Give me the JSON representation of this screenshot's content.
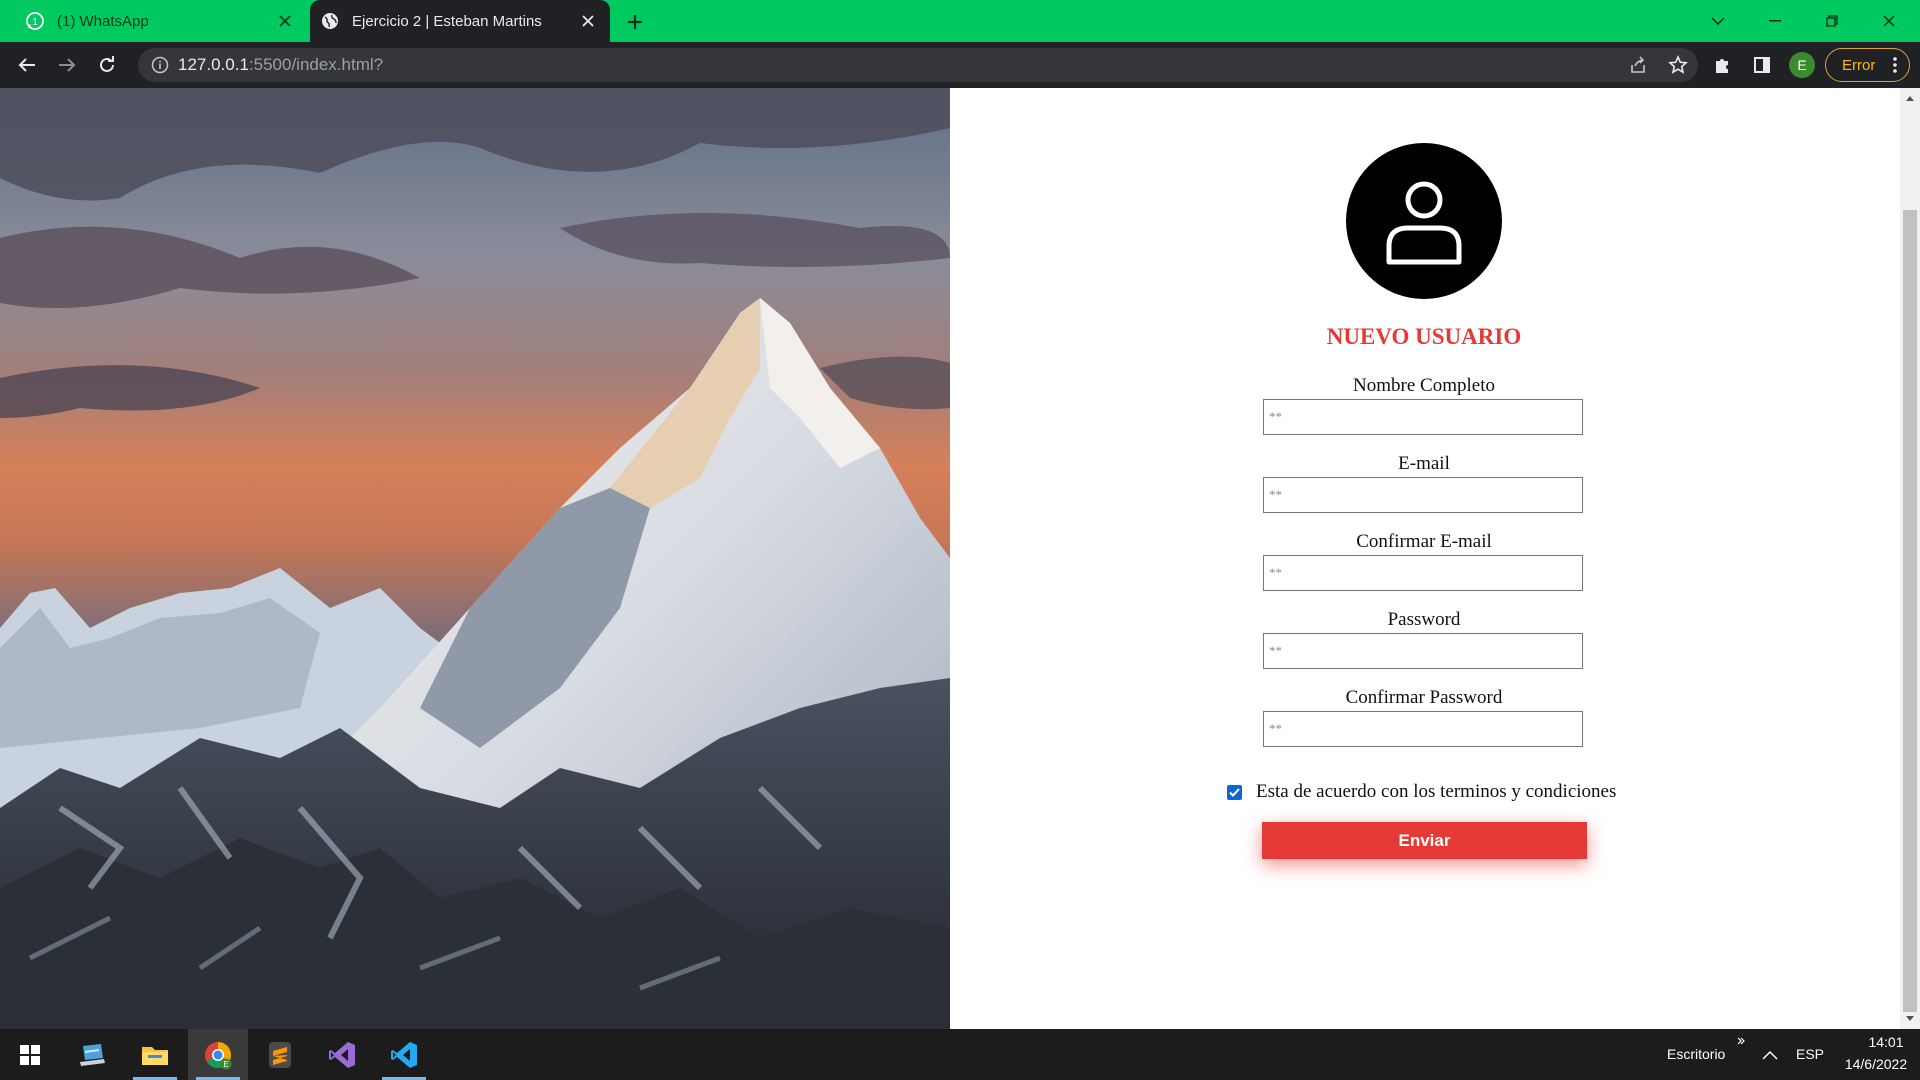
{
  "browser": {
    "tabs": [
      {
        "title": "(1) WhatsApp",
        "icon": "whatsapp-icon",
        "active": false
      },
      {
        "title": "Ejercicio 2 | Esteban Martins",
        "icon": "globe-icon",
        "active": true
      }
    ],
    "url_host": "127.0.0.1",
    "url_rest": ":5500/index.html?",
    "profile_initial": "E",
    "error_label": "Error",
    "accent_color": "#00c95f"
  },
  "form": {
    "title": "NUEVO USUARIO",
    "fields": [
      {
        "label": "Nombre Completo",
        "placeholder": "**"
      },
      {
        "label": "E-mail",
        "placeholder": "**"
      },
      {
        "label": "Confirmar E-mail",
        "placeholder": "**"
      },
      {
        "label": "Password",
        "placeholder": "**"
      },
      {
        "label": "Confirmar Password",
        "placeholder": "**"
      }
    ],
    "terms_text": "Esta de acuerdo con los terminos y condiciones",
    "terms_checked": true,
    "submit_label": "Enviar",
    "accent_color": "#e53935"
  },
  "taskbar": {
    "apps": [
      {
        "name": "windows-start",
        "icon": "windows-icon"
      },
      {
        "name": "desktop-app",
        "icon": "laptop-icon"
      },
      {
        "name": "file-explorer",
        "icon": "folder-icon"
      },
      {
        "name": "chrome",
        "icon": "chrome-icon"
      },
      {
        "name": "sublime-text",
        "icon": "sublime-icon"
      },
      {
        "name": "visual-studio",
        "icon": "visual-studio-icon"
      },
      {
        "name": "vscode",
        "icon": "vscode-icon"
      }
    ],
    "desktop_label": "Escritorio",
    "language": "ESP",
    "time": "14:01",
    "date": "14/6/2022"
  }
}
